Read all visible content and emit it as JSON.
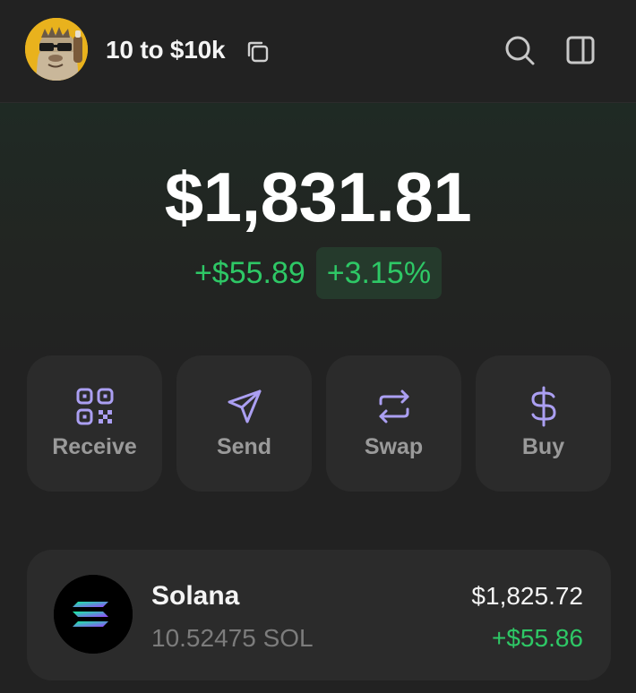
{
  "header": {
    "account_name": "10 to $10k",
    "avatar_icon": "character-avatar",
    "copy_icon": "copy-icon",
    "search_icon": "search-icon",
    "panel_icon": "side-panel-icon"
  },
  "portfolio": {
    "balance": "$1,831.81",
    "change_amount": "+$55.89",
    "change_percent": "+3.15%",
    "positive_color": "#2ec866"
  },
  "actions": [
    {
      "label": "Receive",
      "icon": "qr-code-icon"
    },
    {
      "label": "Send",
      "icon": "send-arrow-icon"
    },
    {
      "label": "Swap",
      "icon": "swap-arrows-icon"
    },
    {
      "label": "Buy",
      "icon": "dollar-icon"
    }
  ],
  "accent_color": "#ab9ff2",
  "tokens": [
    {
      "name": "Solana",
      "amount": "10.52475 SOL",
      "value": "$1,825.72",
      "change": "+$55.86",
      "icon": "solana-logo"
    }
  ]
}
